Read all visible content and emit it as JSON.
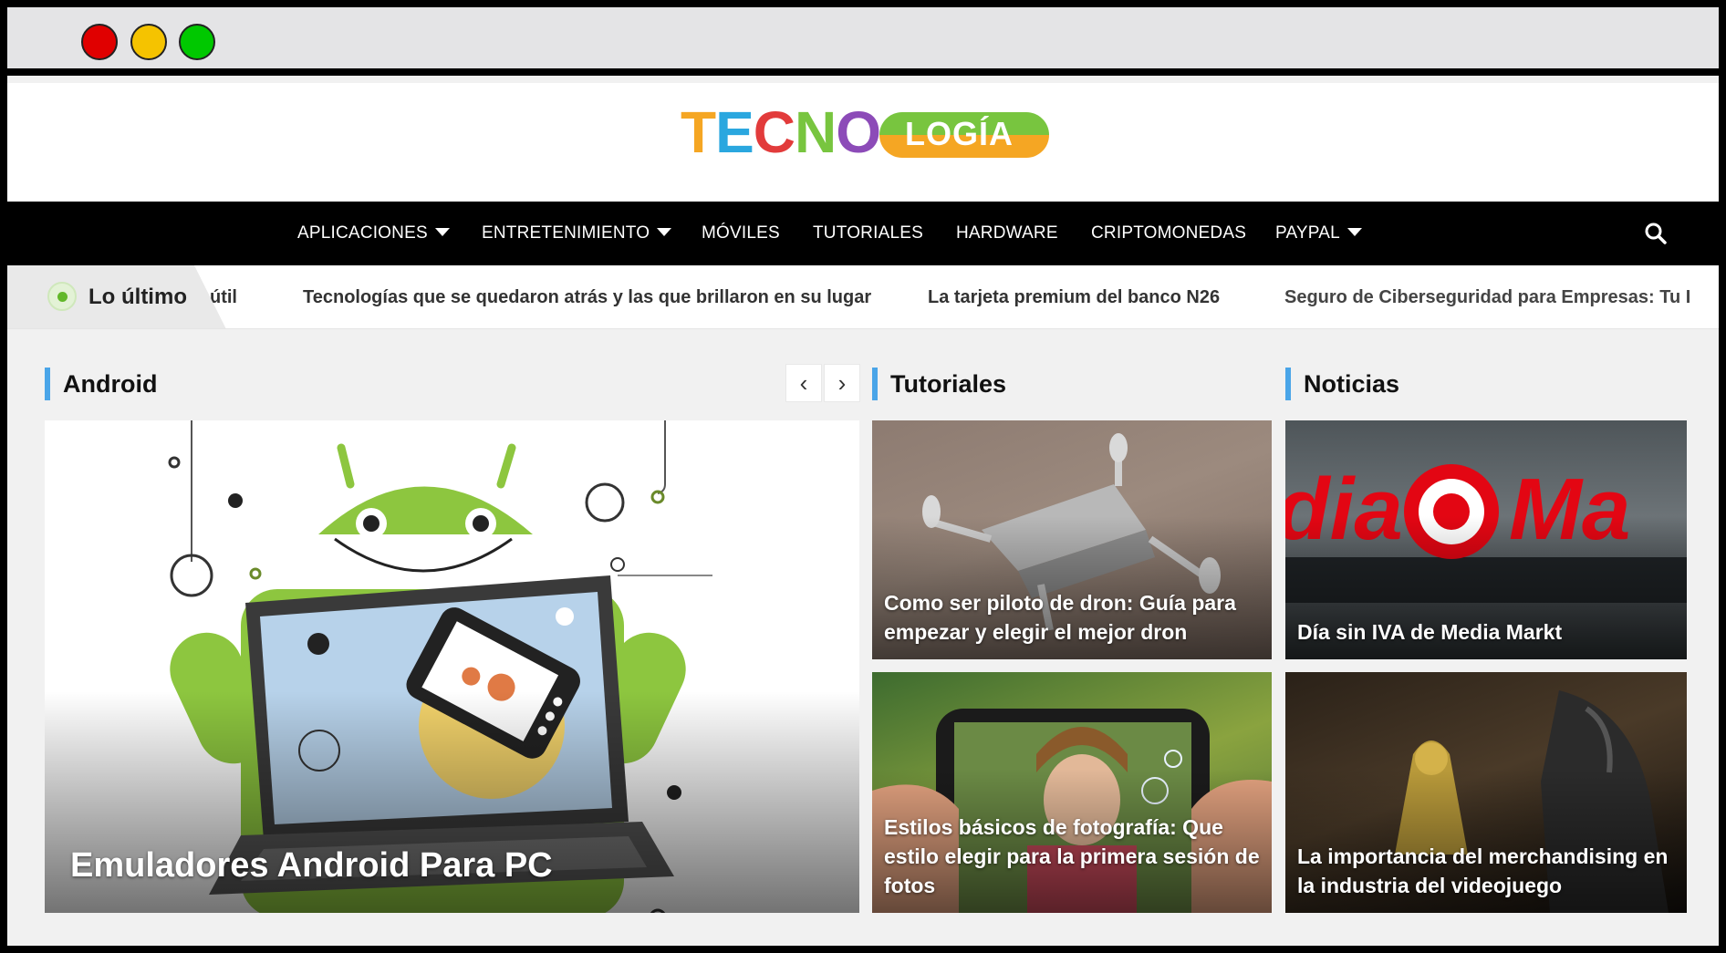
{
  "site": {
    "logo_left": "TECNO",
    "logo_right": "LOGÍA"
  },
  "nav": {
    "items": [
      {
        "label": "APLICACIONES",
        "dropdown": true
      },
      {
        "label": "ENTRETENIMIENTO",
        "dropdown": true
      },
      {
        "label": "MÓVILES",
        "dropdown": false
      },
      {
        "label": "TUTORIALES",
        "dropdown": false
      },
      {
        "label": "HARDWARE",
        "dropdown": false
      },
      {
        "label": "CRIPTOMONEDAS",
        "dropdown": false
      },
      {
        "label": "PAYPAL",
        "dropdown": true
      }
    ],
    "search_icon": "search-icon"
  },
  "ticker": {
    "title": "Lo último",
    "items": [
      "útil",
      "Tecnologías que se quedaron atrás y las que brillaron en su lugar",
      "La tarjeta premium del banco N26",
      "Seguro de Ciberseguridad para Empresas: Tu I"
    ]
  },
  "sections": {
    "android": {
      "title": "Android",
      "prev_icon": "chevron-left-icon",
      "next_icon": "chevron-right-icon",
      "prev_label": "‹",
      "next_label": "›",
      "feature_title": "Emuladores Android Para PC"
    },
    "tutoriales": {
      "title": "Tutoriales",
      "posts": [
        "Como ser piloto de dron: Guía para empezar y elegir el mejor dron",
        "Estilos básicos de fotografía: Que estilo elegir para la primera sesión de fotos"
      ]
    },
    "noticias": {
      "title": "Noticias",
      "posts": [
        "Día sin IVA de Media Markt",
        "La importancia del merchandising en la industria del videojuego"
      ]
    }
  },
  "colors": {
    "accent": "#4aa5e8",
    "nav_bg": "#000000",
    "ticker_dot": "#62b82a"
  }
}
